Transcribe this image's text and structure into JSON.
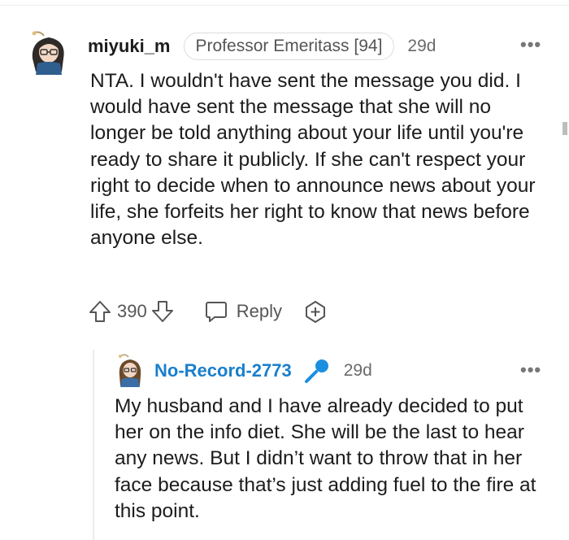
{
  "comment": {
    "username": "miyuki_m",
    "flair": "Professor Emeritass [94]",
    "age": "29d",
    "more": "•••",
    "body": "NTA. I wouldn't have sent the message you did. I would have sent the message that she will no longer be told anything about your life until you're ready to share it publicly. If she can't respect your right to decide when to announce news about your life, she forfeits her right to know that news before anyone else.",
    "score": "390",
    "reply_label": "Reply"
  },
  "reply": {
    "username": "No-Record-2773",
    "age": "29d",
    "more": "•••",
    "body": "My husband and I have already decided to put her on the info diet. She will be the last to hear any news. But I didn’t want to throw that in her face because that’s just adding fuel to the fire at this point."
  },
  "icons": [
    "avatar-icon",
    "upvote-icon",
    "downvote-icon",
    "reply-icon",
    "award-icon",
    "microphone-icon",
    "more-icon"
  ],
  "colors": {
    "username_reply": "#1a7fcc",
    "mic_icon": "#1a8fe0",
    "text": "#1c1c1c",
    "muted": "#6a6a6a"
  }
}
